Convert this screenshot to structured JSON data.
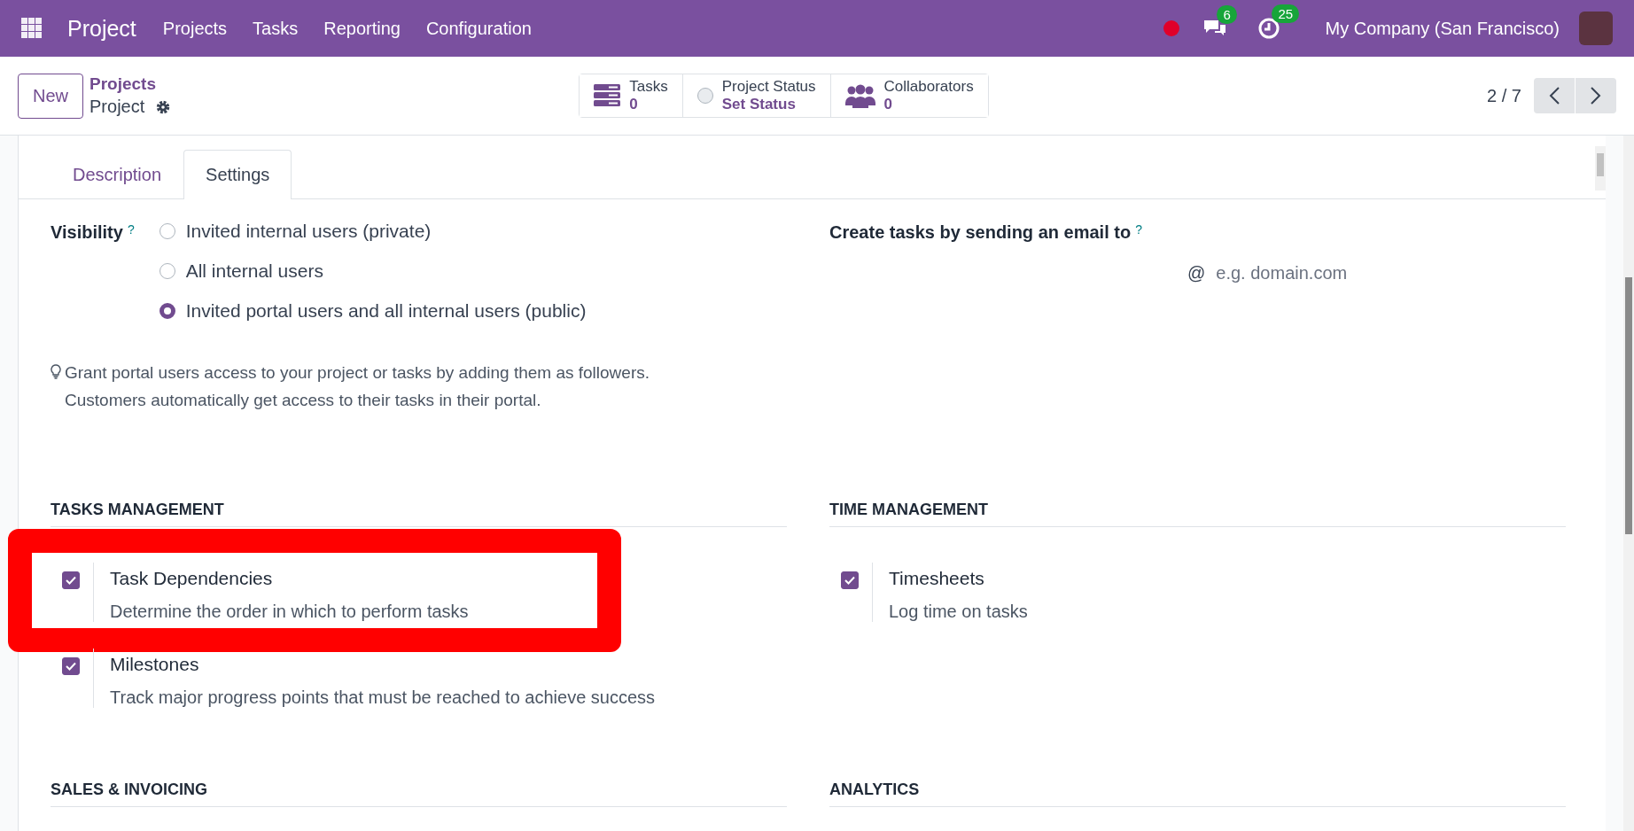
{
  "navbar": {
    "app_name": "Project",
    "menu": [
      "Projects",
      "Tasks",
      "Reporting",
      "Configuration"
    ],
    "messages_count": "6",
    "activities_count": "25",
    "company": "My Company (San Francisco)"
  },
  "control_panel": {
    "new_button": "New",
    "breadcrumb_parent": "Projects",
    "breadcrumb_current": "Project",
    "smart_buttons": [
      {
        "kind": "tasks",
        "label": "Tasks",
        "value": "0"
      },
      {
        "kind": "status",
        "label": "Project Status",
        "value": "Set Status"
      },
      {
        "kind": "collaborators",
        "label": "Collaborators",
        "value": "0"
      }
    ],
    "pager": "2 / 7"
  },
  "tabs": [
    {
      "label": "Description",
      "selected": false
    },
    {
      "label": "Settings",
      "selected": true
    }
  ],
  "visibility": {
    "label": "Visibility",
    "help": "?",
    "options": [
      {
        "label": "Invited internal users (private)",
        "selected": false
      },
      {
        "label": "All internal users",
        "selected": false
      },
      {
        "label": "Invited portal users and all internal users (public)",
        "selected": true
      }
    ],
    "hint": [
      "Grant portal users access to your project or tasks by adding them as followers.",
      "Customers automatically get access to their tasks in their portal."
    ]
  },
  "email": {
    "label": "Create tasks by sending an email to",
    "help": "?",
    "prefix": "@",
    "placeholder": "e.g. domain.com"
  },
  "sections": [
    {
      "title": "TASKS MANAGEMENT",
      "settings": [
        {
          "label": "Task Dependencies",
          "description": "Determine the order in which to perform tasks",
          "checked": true,
          "highlighted": true
        },
        {
          "label": "Milestones",
          "description": "Track major progress points that must be reached to achieve success",
          "checked": true,
          "highlighted": false
        }
      ]
    },
    {
      "title": "TIME MANAGEMENT",
      "settings": [
        {
          "label": "Timesheets",
          "description": "Log time on tasks",
          "checked": true,
          "highlighted": false
        }
      ]
    },
    {
      "title": "SALES & INVOICING"
    },
    {
      "title": "ANALYTICS"
    }
  ]
}
